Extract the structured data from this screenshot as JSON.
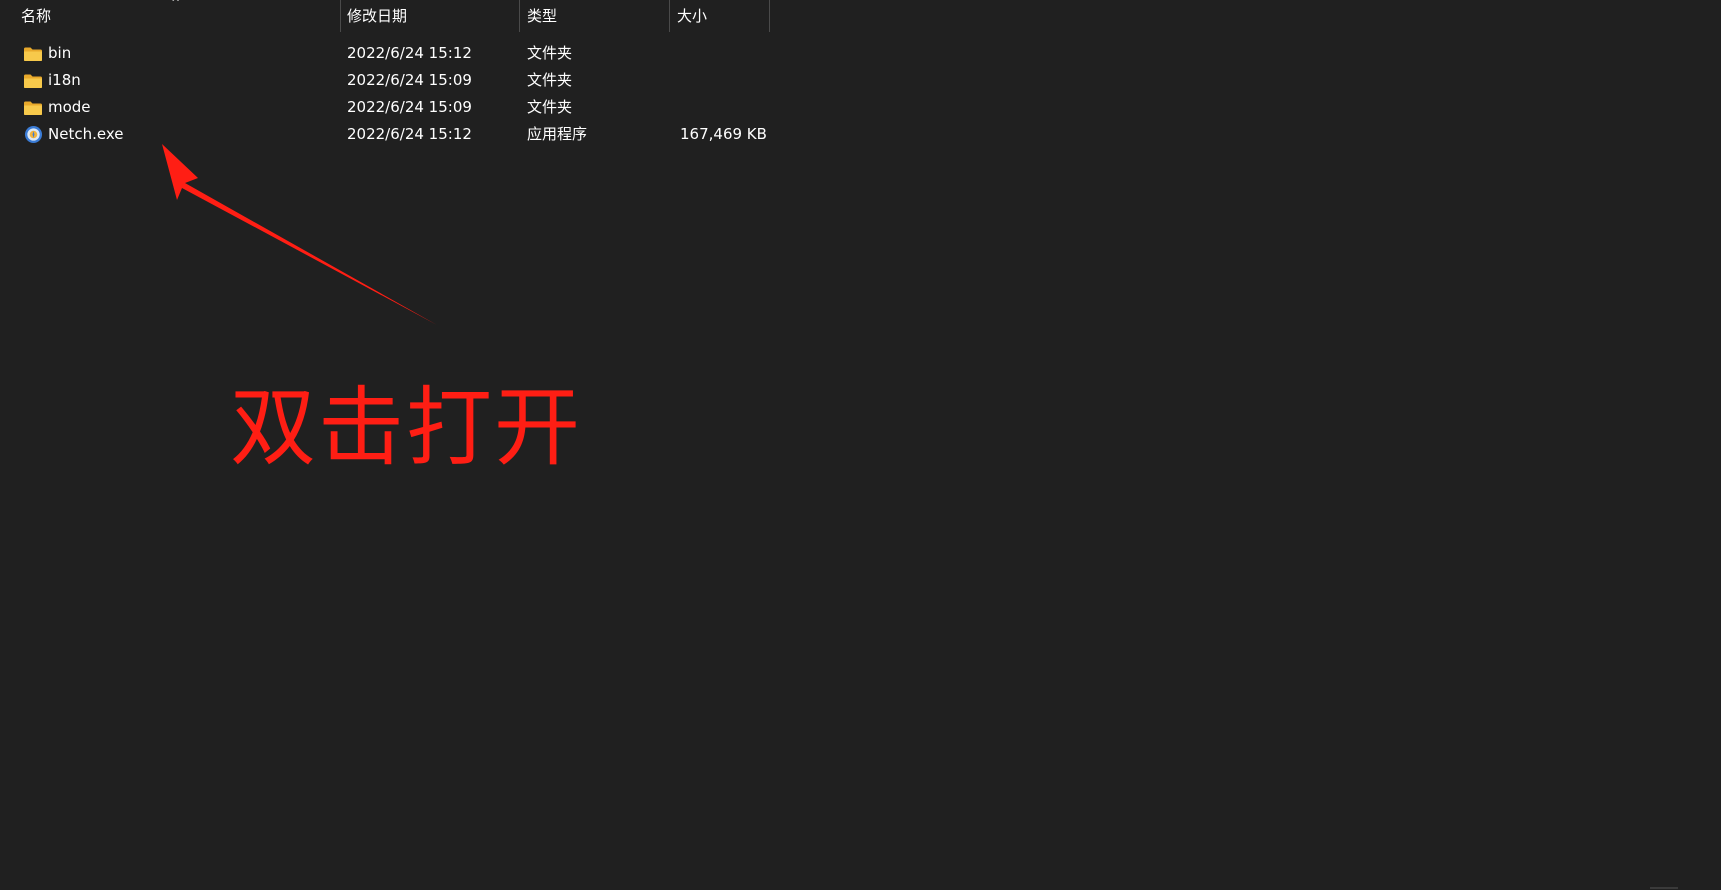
{
  "columns": {
    "name": "名称",
    "date": "修改日期",
    "type": "类型",
    "size": "大小"
  },
  "files": [
    {
      "name": "bin",
      "date": "2022/6/24 15:12",
      "type": "文件夹",
      "size": "",
      "icon": "folder-icon"
    },
    {
      "name": "i18n",
      "date": "2022/6/24 15:09",
      "type": "文件夹",
      "size": "",
      "icon": "folder-icon"
    },
    {
      "name": "mode",
      "date": "2022/6/24 15:09",
      "type": "文件夹",
      "size": "",
      "icon": "folder-icon"
    },
    {
      "name": "Netch.exe",
      "date": "2022/6/24 15:12",
      "type": "应用程序",
      "size": "167,469 KB",
      "icon": "app-icon"
    }
  ],
  "annotation": {
    "text": "双击打开",
    "color": "#ff1e14"
  },
  "colors": {
    "background": "#202020",
    "text": "#ffffff",
    "folder": "#f7c94b",
    "app_icon": "#3a7bd5"
  }
}
